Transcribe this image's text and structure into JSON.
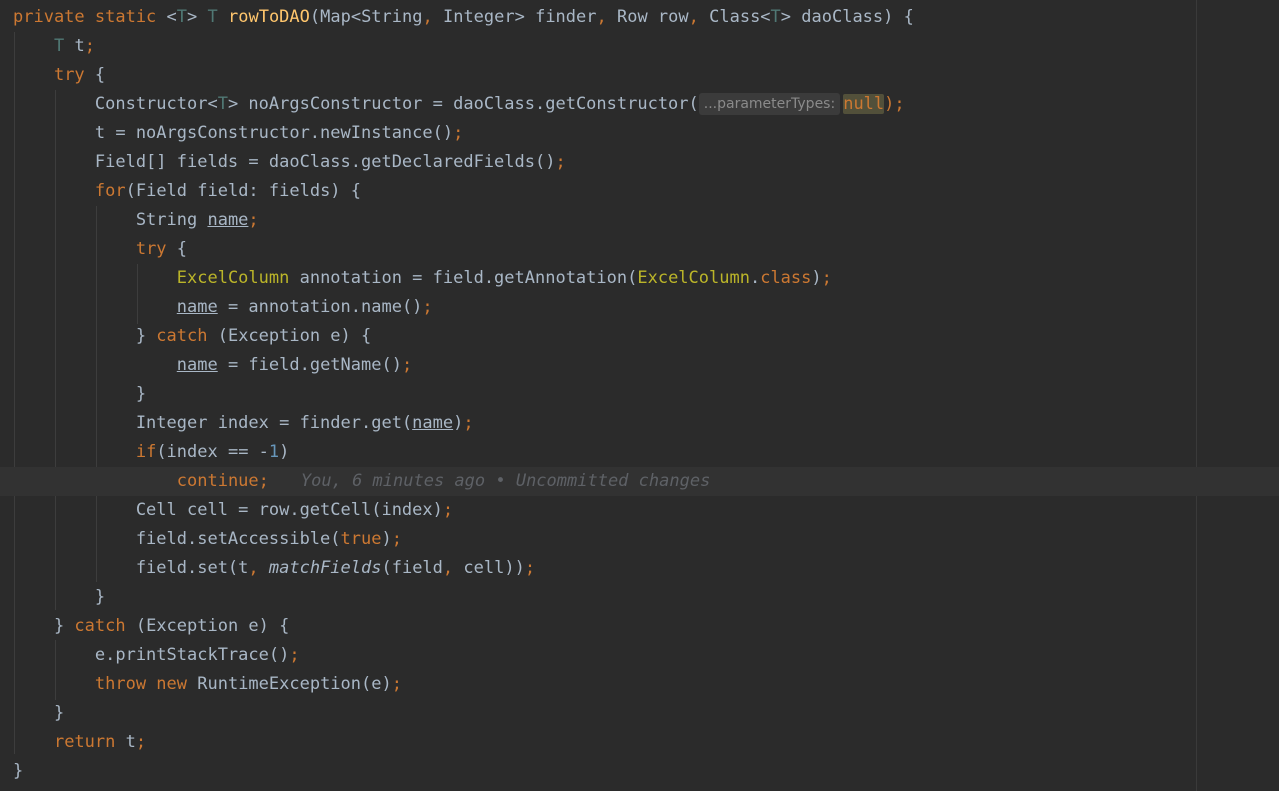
{
  "code_editor": {
    "lines": [
      {
        "parts": [
          [
            "private static ",
            "kw"
          ],
          [
            "<",
            "p"
          ],
          [
            "T",
            "tp"
          ],
          [
            "> ",
            "p"
          ],
          [
            "T ",
            "tp"
          ],
          [
            "rowToDAO",
            "fn"
          ],
          [
            "(Map<String",
            "p"
          ],
          [
            ", ",
            "kw"
          ],
          [
            "Integer> finder",
            "p"
          ],
          [
            ", ",
            "kw"
          ],
          [
            "Row row",
            "p"
          ],
          [
            ", ",
            "kw"
          ],
          [
            "Class<",
            "p"
          ],
          [
            "T",
            "tp"
          ],
          [
            "> daoClass) {",
            "p"
          ]
        ]
      },
      {
        "parts": [
          [
            "    ",
            "p"
          ],
          [
            "T ",
            "tp"
          ],
          [
            "t",
            "p"
          ],
          [
            ";",
            "kw"
          ]
        ]
      },
      {
        "parts": [
          [
            "    ",
            "p"
          ],
          [
            "try ",
            "kw"
          ],
          [
            "{",
            "p"
          ]
        ]
      },
      {
        "parts": [
          [
            "        Constructor<",
            "p"
          ],
          [
            "T",
            "tp"
          ],
          [
            "> noArgsConstructor = daoClass.getConstructor(",
            "p"
          ],
          [
            "...parameterTypes:",
            "hint"
          ],
          [
            "null",
            "kw hl"
          ],
          [
            ");",
            "kw"
          ]
        ]
      },
      {
        "parts": [
          [
            "        t = noArgsConstructor.newInstance()",
            "p"
          ],
          [
            ";",
            "kw"
          ]
        ]
      },
      {
        "parts": [
          [
            "        Field[] fields = daoClass.getDeclaredFields()",
            "p"
          ],
          [
            ";",
            "kw"
          ]
        ]
      },
      {
        "parts": [
          [
            "        ",
            "p"
          ],
          [
            "for",
            "kw"
          ],
          [
            "(Field field: fields) {",
            "p"
          ]
        ]
      },
      {
        "parts": [
          [
            "            String ",
            "p"
          ],
          [
            "name",
            "ul"
          ],
          [
            ";",
            "kw"
          ]
        ]
      },
      {
        "parts": [
          [
            "            ",
            "p"
          ],
          [
            "try ",
            "kw"
          ],
          [
            "{",
            "p"
          ]
        ]
      },
      {
        "parts": [
          [
            "                ",
            "p"
          ],
          [
            "ExcelColumn",
            "an"
          ],
          [
            " annotation = field.getAnnotation(",
            "p"
          ],
          [
            "ExcelColumn",
            "an"
          ],
          [
            ".",
            "p"
          ],
          [
            "class",
            "kw"
          ],
          [
            ")",
            "p"
          ],
          [
            ";",
            "kw"
          ]
        ]
      },
      {
        "parts": [
          [
            "                ",
            "p"
          ],
          [
            "name",
            "ul"
          ],
          [
            " = annotation.name()",
            "p"
          ],
          [
            ";",
            "kw"
          ]
        ]
      },
      {
        "parts": [
          [
            "            } ",
            "p"
          ],
          [
            "catch ",
            "kw"
          ],
          [
            "(Exception e) {",
            "p"
          ]
        ]
      },
      {
        "parts": [
          [
            "                ",
            "p"
          ],
          [
            "name",
            "ul"
          ],
          [
            " = field.getName()",
            "p"
          ],
          [
            ";",
            "kw"
          ]
        ]
      },
      {
        "parts": [
          [
            "            }",
            "p"
          ]
        ]
      },
      {
        "parts": [
          [
            "            Integer index = finder.get(",
            "p"
          ],
          [
            "name",
            "ul"
          ],
          [
            ")",
            "p"
          ],
          [
            ";",
            "kw"
          ]
        ]
      },
      {
        "parts": [
          [
            "            ",
            "p"
          ],
          [
            "if",
            "kw"
          ],
          [
            "(index == -",
            "p"
          ],
          [
            "1",
            "num"
          ],
          [
            ")",
            "p"
          ]
        ]
      },
      {
        "parts": [
          [
            "                ",
            "p"
          ],
          [
            "continue",
            "kw"
          ],
          [
            ";",
            "kw"
          ],
          [
            "You, 6 minutes ago • Uncommitted changes",
            "blame"
          ]
        ]
      },
      {
        "parts": [
          [
            "            Cell cell = row.getCell(index)",
            "p"
          ],
          [
            ";",
            "kw"
          ]
        ]
      },
      {
        "parts": [
          [
            "            field.setAccessible(",
            "p"
          ],
          [
            "true",
            "kw"
          ],
          [
            ")",
            "p"
          ],
          [
            ";",
            "kw"
          ]
        ]
      },
      {
        "parts": [
          [
            "            field.set(t",
            "p"
          ],
          [
            ", ",
            "kw"
          ],
          [
            "matchFields",
            "it"
          ],
          [
            "(field",
            "p"
          ],
          [
            ", ",
            "kw"
          ],
          [
            "cell))",
            "p"
          ],
          [
            ";",
            "kw"
          ]
        ]
      },
      {
        "parts": [
          [
            "        }",
            "p"
          ]
        ]
      },
      {
        "parts": [
          [
            "    } ",
            "p"
          ],
          [
            "catch ",
            "kw"
          ],
          [
            "(Exception e) {",
            "p"
          ]
        ]
      },
      {
        "parts": [
          [
            "        e.printStackTrace()",
            "p"
          ],
          [
            ";",
            "kw"
          ]
        ]
      },
      {
        "parts": [
          [
            "        ",
            "p"
          ],
          [
            "throw new ",
            "kw"
          ],
          [
            "RuntimeException(e)",
            "p"
          ],
          [
            ";",
            "kw"
          ]
        ]
      },
      {
        "parts": [
          [
            "    }",
            "p"
          ]
        ]
      },
      {
        "parts": [
          [
            "    ",
            "p"
          ],
          [
            "return ",
            "kw"
          ],
          [
            "t",
            "p"
          ],
          [
            ";",
            "kw"
          ]
        ]
      },
      {
        "parts": [
          [
            "}",
            "p"
          ]
        ]
      }
    ]
  },
  "colors": {
    "background": "#2b2b2b",
    "keyword": "#cc7832",
    "type_param": "#507874",
    "method_decl": "#ffc66d",
    "annotation": "#bbb529",
    "default_text": "#a9b7c6",
    "number": "#6897bb",
    "current_line": "#323232"
  }
}
